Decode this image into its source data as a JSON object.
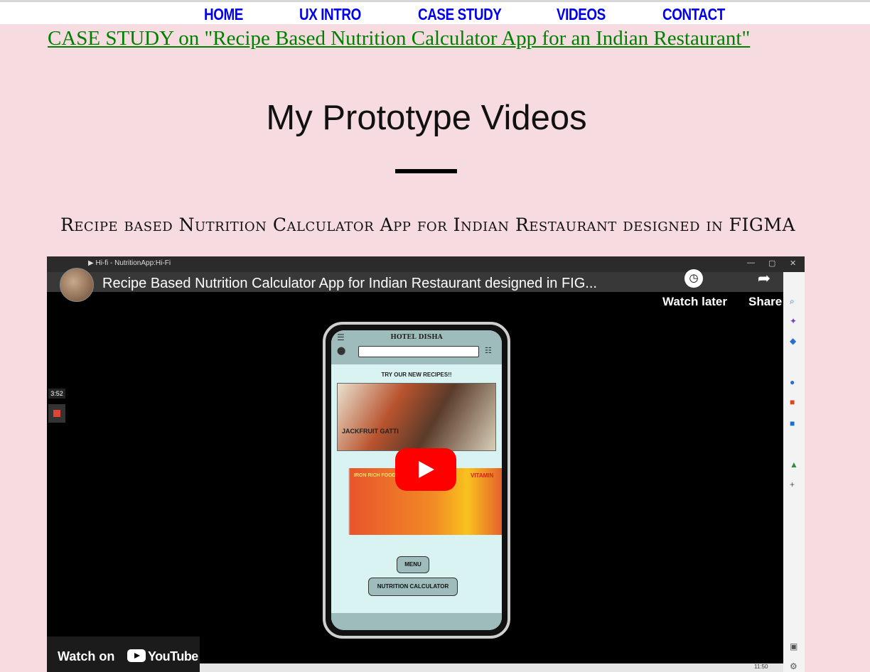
{
  "nav": {
    "items": [
      "HOME",
      "UX INTRO",
      "CASE STUDY",
      "VIDEOS",
      "CONTACT"
    ]
  },
  "case_study_link": "CASE STUDY on \"Recipe Based Nutrition Calculator App for an Indian Restaurant\"",
  "page_title": "My Prototype Videos",
  "video_heading": "Recipe based Nutrition Calculator App for Indian Restaurant designed in FIGMA",
  "player": {
    "browser_tab": "▶ Hi-fi - NutritionApp:Hi-Fi",
    "video_title": "Recipe Based Nutrition Calculator App for Indian Restaurant designed in FIG...",
    "watch_later": "Watch later",
    "share": "Share",
    "timer": "3:52",
    "watch_on": "Watch on",
    "youtube": "YouTube",
    "clock": "11:50",
    "colors": {
      "play": "#ff0000",
      "background": "#000000"
    }
  },
  "prototype": {
    "hotel_name": "HOTEL DISHA",
    "try_label": "TRY OUR NEW RECIPES!!",
    "food_caption": "JACKFRUIT GATTI",
    "banner_text": "IRON RICH FOODS",
    "vitamin": "VITAMIN",
    "menu_button": "MENU",
    "calculator_button": "NUTRITION CALCULATOR"
  }
}
